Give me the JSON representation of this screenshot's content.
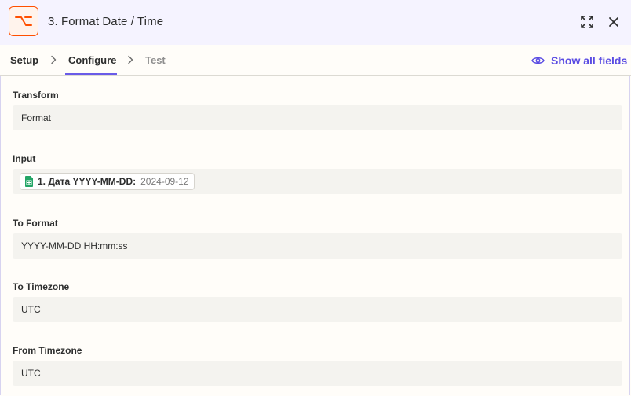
{
  "header": {
    "title": "3. Format Date / Time",
    "app_icon": "formatter-icon",
    "accent": "#ff4f00"
  },
  "tabs": {
    "setup": "Setup",
    "configure": "Configure",
    "test": "Test",
    "active": "Configure"
  },
  "show_all_fields": "Show all fields",
  "fields": {
    "transform": {
      "label": "Transform",
      "value": "Format"
    },
    "input": {
      "label": "Input",
      "pill": {
        "icon": "google-sheets-icon",
        "label": "1. Дата YYYY-MM-DD:",
        "value": "2024-09-12"
      }
    },
    "to_format": {
      "label": "To Format",
      "value": "YYYY-MM-DD HH:mm:ss"
    },
    "to_timezone": {
      "label": "To Timezone",
      "value": "UTC"
    },
    "from_timezone": {
      "label": "From Timezone",
      "value": "UTC"
    }
  },
  "colors": {
    "header_bg": "#f5f3ff",
    "link": "#5a4ce3",
    "field_bg": "#f4f3ef"
  }
}
